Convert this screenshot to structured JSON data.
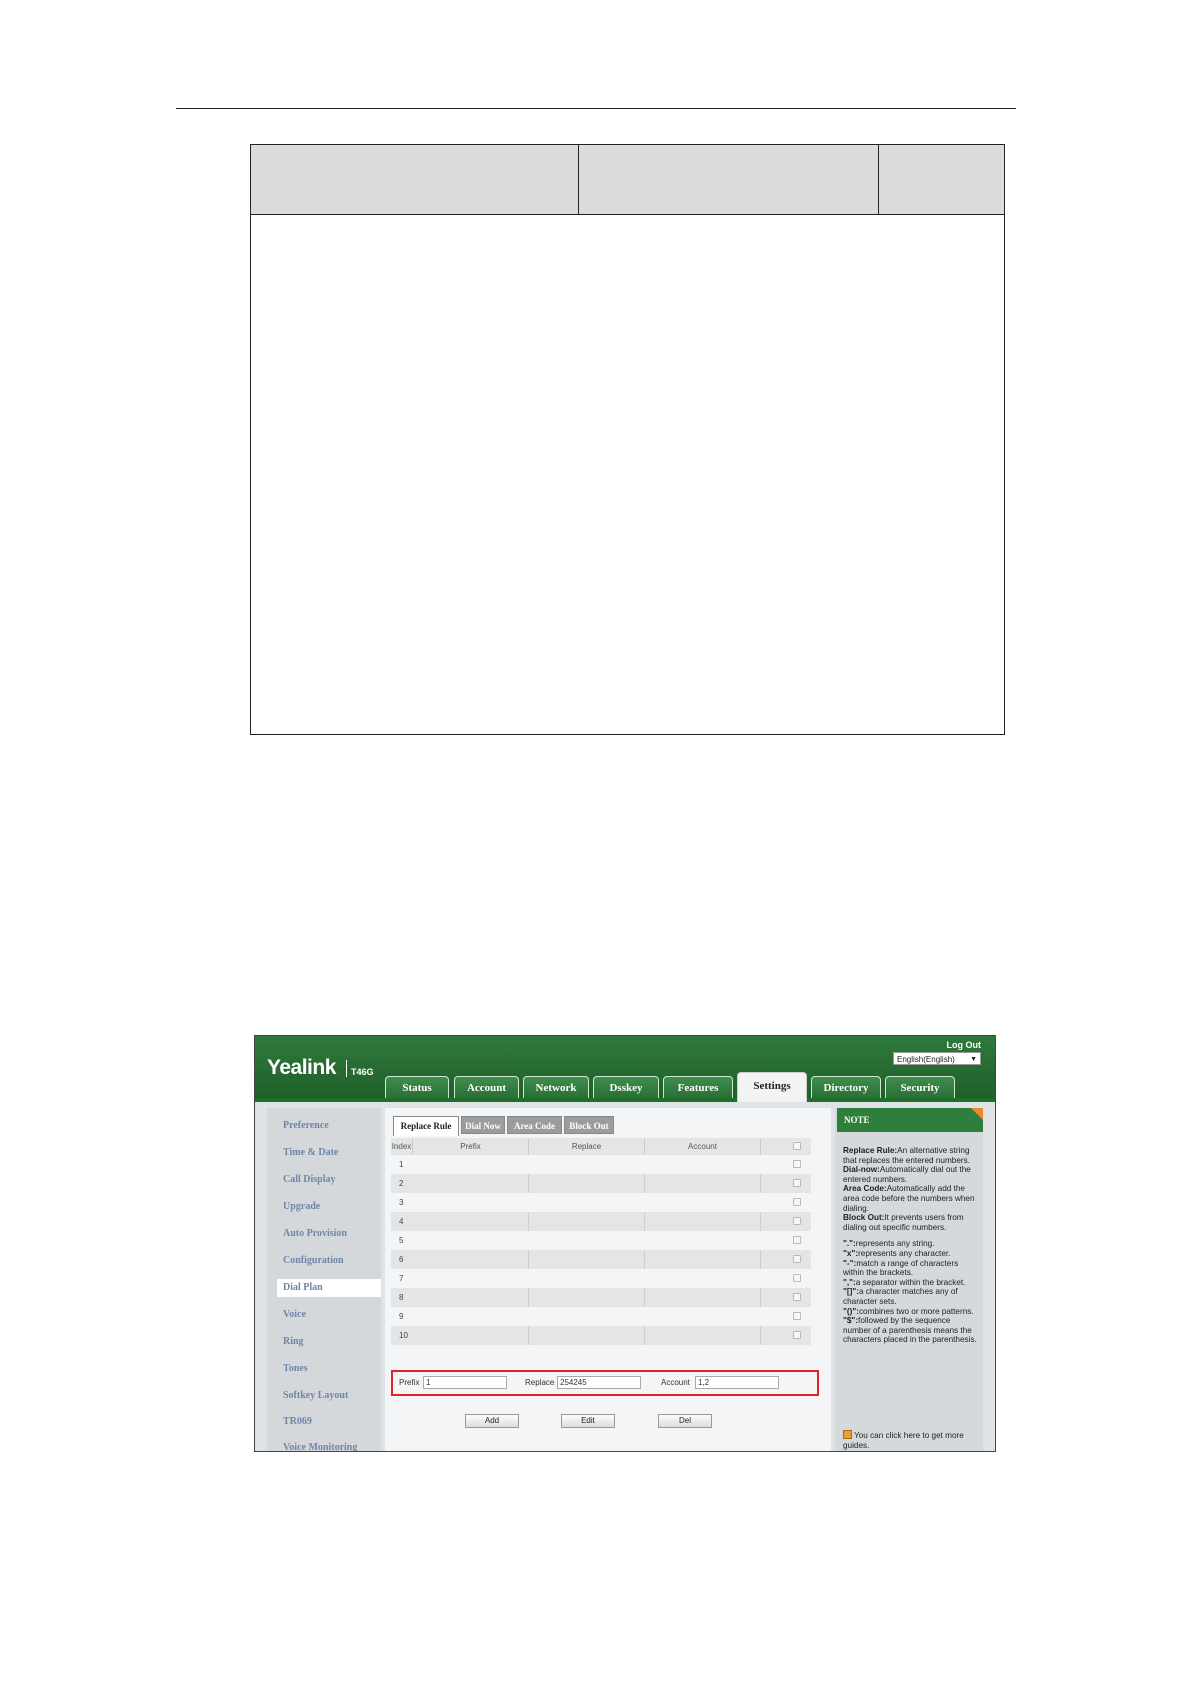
{
  "header_bar": {
    "logo": "Yealink",
    "model": "T46G",
    "logout": "Log Out",
    "language": "English(English)",
    "language_arrow": "▼"
  },
  "main_tabs": [
    {
      "label": "Status",
      "active": false
    },
    {
      "label": "Account",
      "active": false
    },
    {
      "label": "Network",
      "active": false
    },
    {
      "label": "Dsskey",
      "active": false
    },
    {
      "label": "Features",
      "active": false
    },
    {
      "label": "Settings",
      "active": true
    },
    {
      "label": "Directory",
      "active": false
    },
    {
      "label": "Security",
      "active": false
    }
  ],
  "sidebar": {
    "items": [
      "Preference",
      "Time & Date",
      "Call Display",
      "Upgrade",
      "Auto Provision",
      "Configuration",
      "Dial Plan",
      "Voice",
      "Ring",
      "Tones",
      "Softkey Layout",
      "TR069",
      "Voice Monitoring"
    ],
    "active": "Dial Plan"
  },
  "sub_tabs": [
    "Replace Rule",
    "Dial Now",
    "Area Code",
    "Block Out"
  ],
  "table": {
    "columns": [
      "Index",
      "Prefix",
      "Replace",
      "Account"
    ],
    "rows": [
      "1",
      "2",
      "3",
      "4",
      "5",
      "6",
      "7",
      "8",
      "9",
      "10"
    ]
  },
  "form": {
    "prefix_label": "Prefix",
    "prefix_value": "1",
    "replace_label": "Replace",
    "replace_value": "254245",
    "account_label": "Account",
    "account_value": "1,2"
  },
  "buttons": {
    "add": "Add",
    "edit": "Edit",
    "del": "Del"
  },
  "note": {
    "title": "NOTE",
    "defs": [
      {
        "term": "Replace Rule:",
        "text": "An alternative string that replaces the entered numbers."
      },
      {
        "term": "Dial-now:",
        "text": "Automatically dial out the entered numbers."
      },
      {
        "term": "Area Code:",
        "text": "Automatically add the area code before the numbers when dialing."
      },
      {
        "term": "Block Out:",
        "text": "It prevents users from dialing out specific numbers."
      }
    ],
    "patterns": [
      {
        "term": "\".\":",
        "text": "represents any string."
      },
      {
        "term": "\"x\":",
        "text": "represents any character."
      },
      {
        "term": "\"-\":",
        "text": "match a range of characters within the brackets."
      },
      {
        "term": "\",\":",
        "text": "a separator within the bracket."
      },
      {
        "term": "\"[]\":",
        "text": "a character matches any of character sets."
      },
      {
        "term": "\"()\":",
        "text": "combines two or more patterns."
      },
      {
        "term": "\"$\":",
        "text": "followed by the sequence number of a parenthesis means the characters placed in the parenthesis."
      }
    ],
    "guide": "You can click here to get more guides."
  },
  "colors": {
    "brand_green": "#2e7f3b",
    "highlight_red": "#e02424",
    "note_corner": "#e88a2c"
  }
}
